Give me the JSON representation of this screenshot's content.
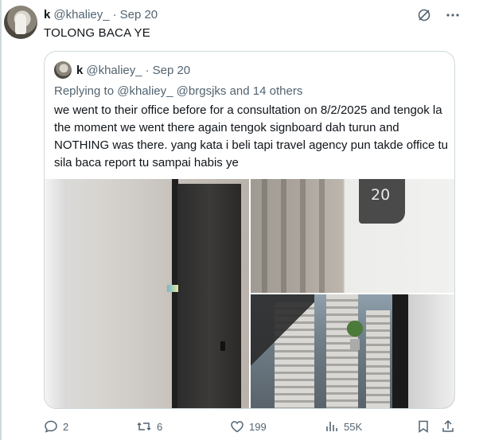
{
  "tweet": {
    "display_name": "k",
    "handle": "@khaliey_",
    "separator": "·",
    "date": "Sep 20",
    "text": "TOLONG BACA YE",
    "icons": [
      "grok-icon",
      "more-icon"
    ]
  },
  "quote": {
    "display_name": "k",
    "handle": "@khaliey_",
    "separator": "·",
    "date": "Sep 20",
    "replying_to_prefix": "Replying to",
    "replying_to_users": [
      "@khaliey_",
      "@brgsjks"
    ],
    "replying_to_suffix": "and 14 others",
    "text": "we went to their office before for a consultation on 8/2/2025 and tengok la the moment we went there again tengok signboard dah turun and NOTHING was there. yang kata i beli tapi travel agency pun takde office tu sila baca report tu sampai habis ye",
    "media": {
      "photo_2_sign_text": "20"
    }
  },
  "actions": {
    "replies": "2",
    "reposts": "6",
    "likes": "199",
    "views": "55K"
  },
  "colors": {
    "text": "#0f1419",
    "secondary": "#536471",
    "border": "#cfd9de"
  }
}
